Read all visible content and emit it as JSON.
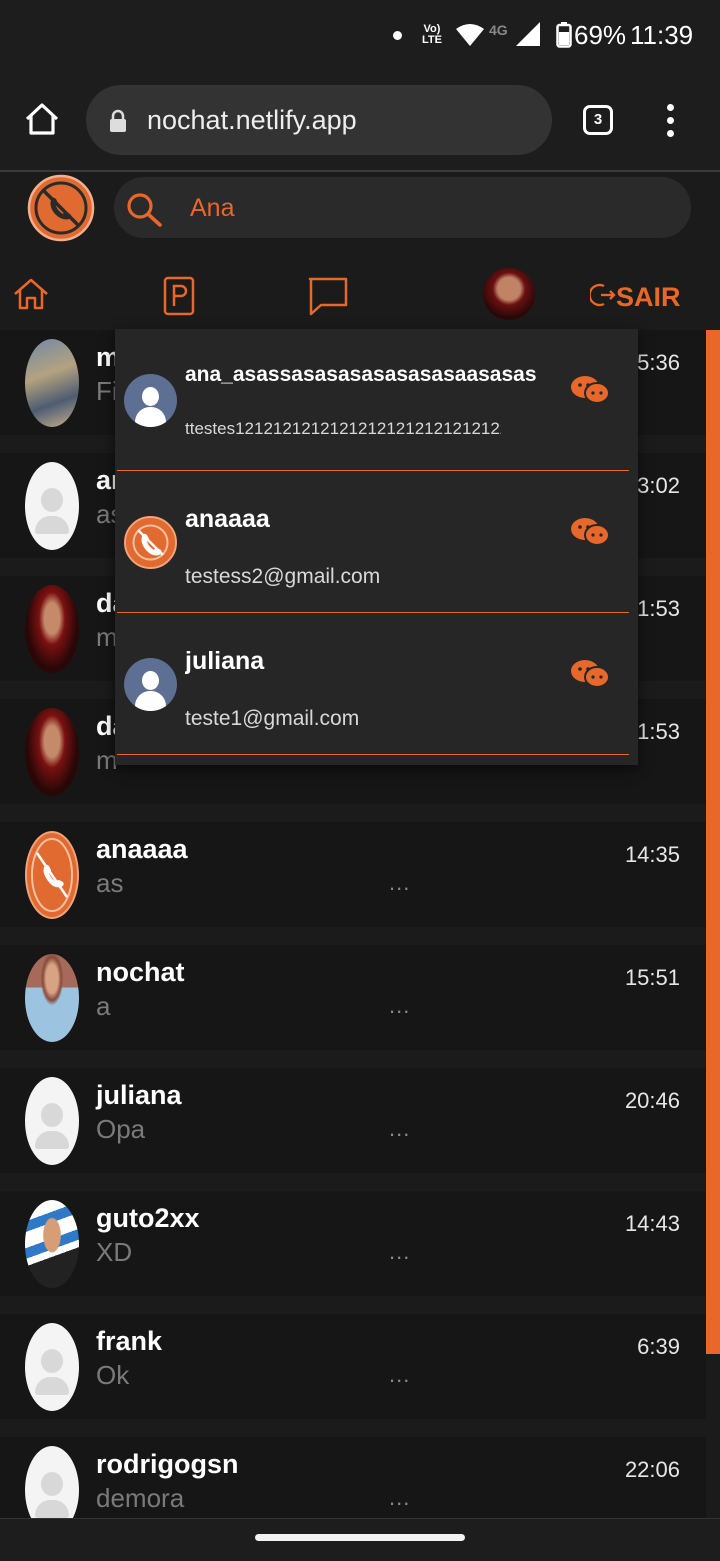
{
  "status_bar": {
    "volte_label": "Vo)\nLTE",
    "network": "4G",
    "battery": "69%",
    "time": "11:39"
  },
  "browser": {
    "url": "nochat.netlify.app",
    "tab_count": "3"
  },
  "search": {
    "value": "Ana",
    "placeholder": ""
  },
  "nav": {
    "logout_label": "SAIR"
  },
  "dropdown": {
    "items": [
      {
        "name": "ana_asassasasasasasasasaasasas",
        "email": "ttestes12121212121212121212121212122",
        "avatar": "default-blue"
      },
      {
        "name": "anaaaa",
        "email": "testess2@gmail.com",
        "avatar": "app-logo"
      },
      {
        "name": "juliana",
        "email": "teste1@gmail.com",
        "avatar": "default-blue"
      }
    ]
  },
  "chats": [
    {
      "name": "m",
      "message": "Fi",
      "time": "5:36"
    },
    {
      "name": "ar",
      "message": "as",
      "time": "3:02"
    },
    {
      "name": "da",
      "message": "m",
      "time": "1:53"
    },
    {
      "name": "da",
      "message": "m",
      "time": "1:53"
    },
    {
      "name": "anaaaa",
      "message": "as",
      "time": "14:35",
      "dots": "..."
    },
    {
      "name": "nochat",
      "message": "a",
      "time": "15:51",
      "dots": "..."
    },
    {
      "name": "juliana",
      "message": "Opa",
      "time": "20:46",
      "dots": "..."
    },
    {
      "name": "guto2xx",
      "message": "XD",
      "time": "14:43",
      "dots": "..."
    },
    {
      "name": "frank",
      "message": "Ok",
      "time": "6:39",
      "dots": "..."
    },
    {
      "name": "rodrigogsn",
      "message": "demora",
      "time": "22:06",
      "dots": "..."
    }
  ],
  "colors": {
    "accent": "#e8672a",
    "background": "#1b1b1b",
    "row": "#161616"
  }
}
